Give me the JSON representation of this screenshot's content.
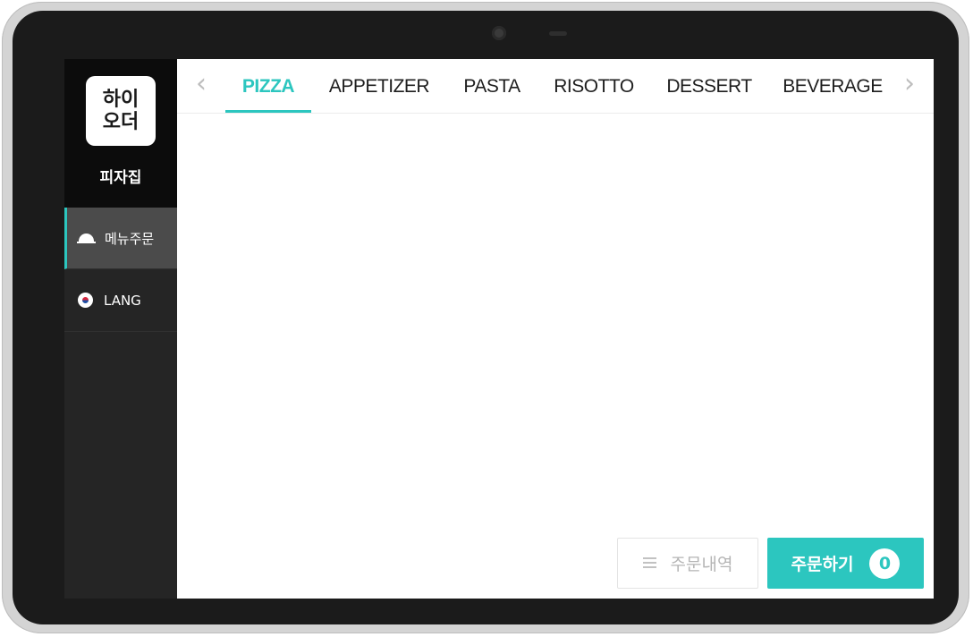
{
  "brand": {
    "logo_line1": "하이",
    "logo_line2": "오더",
    "store_name": "피자집"
  },
  "sidebar": {
    "items": [
      {
        "label": "메뉴주문",
        "icon": "cloche-icon",
        "active": true
      },
      {
        "label": "LANG",
        "icon": "korea-flag-icon",
        "active": false
      }
    ]
  },
  "tabs": {
    "prev_arrow": "‹",
    "next_arrow": "›",
    "items": [
      {
        "label": "PIZZA",
        "active": true
      },
      {
        "label": "APPETIZER"
      },
      {
        "label": "PASTA"
      },
      {
        "label": "RISOTTO"
      },
      {
        "label": "DESSERT"
      },
      {
        "label": "BEVERAGE"
      }
    ]
  },
  "footer": {
    "history_label": "주문내역",
    "order_label": "주문하기",
    "order_count": "0"
  },
  "colors": {
    "accent": "#2cc6bf",
    "sidebar_bg": "#252525",
    "brand_bg": "#0c0c0c"
  }
}
